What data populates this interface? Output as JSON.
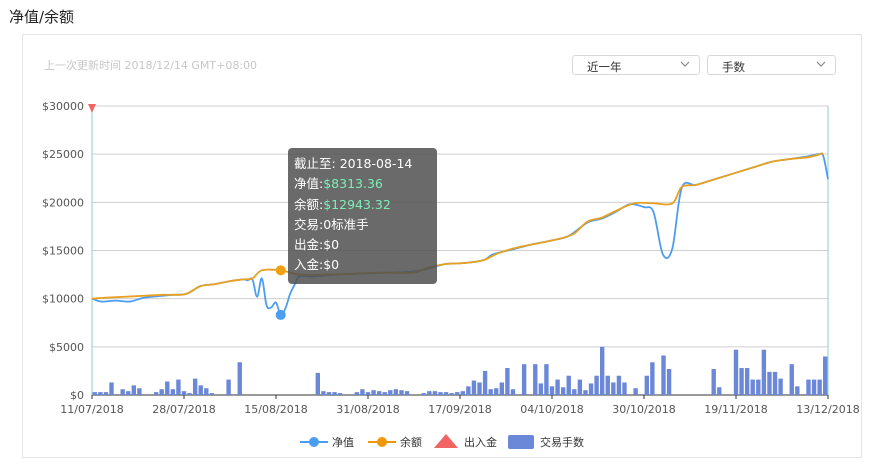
{
  "page": {
    "title": "净值/余额"
  },
  "header": {
    "updated": "上一次更新时间 2018/12/14 GMT+08:00",
    "range_select": "近一年",
    "unit_select": "手数"
  },
  "tooltip": {
    "date_label": "截止至:",
    "date_value": "2018-08-14",
    "equity_label": "净值:",
    "equity_value": "$8313.36",
    "balance_label": "余额:",
    "balance_value": "$12943.32",
    "trade_label": "交易:",
    "trade_value": "0标准手",
    "withdraw_label": "出金:",
    "withdraw_value": "$0",
    "deposit_label": "入金:",
    "deposit_value": "$0"
  },
  "legend": [
    {
      "label": "净值",
      "color": "#4a9df0",
      "icon": "line-circle-icon"
    },
    {
      "label": "余额",
      "color": "#f0960a",
      "icon": "line-circle-icon"
    },
    {
      "label": "出入金",
      "color": "#f06464",
      "icon": "triangle-icon"
    },
    {
      "label": "交易手数",
      "color": "#6b87d8",
      "icon": "bar-rect-icon"
    }
  ],
  "colors": {
    "equity": "#4a9df0",
    "balance": "#e8a020",
    "volume": "#6b87d8",
    "marker": "#f06464"
  },
  "chart_data": {
    "type": "line",
    "x_range": [
      "2018-07-11",
      "2018-12-14"
    ],
    "ylim": [
      0,
      30000
    ],
    "yticks": [
      "$0",
      "$5000",
      "$10000",
      "$15000",
      "$20000",
      "$25000",
      "$30000"
    ],
    "xticks": [
      "11/07/2018",
      "28/07/2018",
      "15/08/2018",
      "31/08/2018",
      "17/09/2018",
      "04/10/2018",
      "30/10/2018",
      "19/11/2018",
      "13/12/2018"
    ],
    "grid": true,
    "legend_position": "bottom",
    "series": [
      {
        "name": "净值",
        "points": [
          [
            "2018-07-11",
            10000
          ],
          [
            "2018-07-13",
            9700
          ],
          [
            "2018-07-16",
            9800
          ],
          [
            "2018-07-19",
            9700
          ],
          [
            "2018-07-22",
            10100
          ],
          [
            "2018-07-26",
            10300
          ],
          [
            "2018-07-28",
            10400
          ],
          [
            "2018-07-31",
            10500
          ],
          [
            "2018-08-03",
            11300
          ],
          [
            "2018-08-06",
            11500
          ],
          [
            "2018-08-09",
            11800
          ],
          [
            "2018-08-12",
            12000
          ],
          [
            "2018-08-13",
            11900
          ],
          [
            "2018-08-14",
            12000
          ],
          [
            "2018-08-15",
            10200
          ],
          [
            "2018-08-16",
            12100
          ],
          [
            "2018-08-17",
            9300
          ],
          [
            "2018-08-18",
            9100
          ],
          [
            "2018-08-19",
            9600
          ],
          [
            "2018-08-20",
            8313
          ],
          [
            "2018-08-21",
            9000
          ],
          [
            "2018-08-22",
            10500
          ],
          [
            "2018-08-23",
            11500
          ],
          [
            "2018-08-24",
            12300
          ],
          [
            "2018-08-27",
            12300
          ],
          [
            "2018-09-01",
            12500
          ],
          [
            "2018-09-06",
            12600
          ],
          [
            "2018-09-12",
            12700
          ],
          [
            "2018-09-17",
            12800
          ],
          [
            "2018-09-20",
            13100
          ],
          [
            "2018-09-24",
            13600
          ],
          [
            "2018-09-28",
            13700
          ],
          [
            "2018-10-02",
            14000
          ],
          [
            "2018-10-04",
            14600
          ],
          [
            "2018-10-08",
            15100
          ],
          [
            "2018-10-12",
            15600
          ],
          [
            "2018-10-16",
            16000
          ],
          [
            "2018-10-20",
            16500
          ],
          [
            "2018-10-24",
            17900
          ],
          [
            "2018-10-27",
            18300
          ],
          [
            "2018-10-30",
            19000
          ],
          [
            "2018-11-02",
            19800
          ],
          [
            "2018-11-05",
            19500
          ],
          [
            "2018-11-07",
            19000
          ],
          [
            "2018-11-09",
            14600
          ],
          [
            "2018-11-11",
            15200
          ],
          [
            "2018-11-13",
            21500
          ],
          [
            "2018-11-16",
            21800
          ],
          [
            "2018-11-20",
            22400
          ],
          [
            "2018-11-24",
            23000
          ],
          [
            "2018-11-28",
            23600
          ],
          [
            "2018-12-02",
            24200
          ],
          [
            "2018-12-06",
            24500
          ],
          [
            "2018-12-10",
            24800
          ],
          [
            "2018-12-12",
            25000
          ],
          [
            "2018-12-13",
            24800
          ],
          [
            "2018-12-14",
            22400
          ]
        ]
      },
      {
        "name": "余额",
        "points": [
          [
            "2018-07-11",
            10000
          ],
          [
            "2018-07-14",
            10100
          ],
          [
            "2018-07-18",
            10200
          ],
          [
            "2018-07-22",
            10300
          ],
          [
            "2018-07-26",
            10400
          ],
          [
            "2018-07-28",
            10400
          ],
          [
            "2018-07-31",
            10500
          ],
          [
            "2018-08-03",
            11300
          ],
          [
            "2018-08-06",
            11500
          ],
          [
            "2018-08-09",
            11800
          ],
          [
            "2018-08-12",
            12000
          ],
          [
            "2018-08-14",
            12100
          ],
          [
            "2018-08-16",
            12943
          ],
          [
            "2018-08-20",
            12943
          ],
          [
            "2018-08-24",
            12500
          ],
          [
            "2018-08-30",
            12500
          ],
          [
            "2018-09-05",
            12600
          ],
          [
            "2018-09-10",
            12700
          ],
          [
            "2018-09-17",
            12700
          ],
          [
            "2018-09-20",
            13200
          ],
          [
            "2018-09-24",
            13600
          ],
          [
            "2018-09-28",
            13700
          ],
          [
            "2018-10-02",
            14000
          ],
          [
            "2018-10-05",
            14700
          ],
          [
            "2018-10-09",
            15300
          ],
          [
            "2018-10-13",
            15700
          ],
          [
            "2018-10-17",
            16100
          ],
          [
            "2018-10-21",
            16700
          ],
          [
            "2018-10-24",
            18000
          ],
          [
            "2018-10-27",
            18400
          ],
          [
            "2018-10-30",
            19100
          ],
          [
            "2018-11-03",
            19900
          ],
          [
            "2018-11-07",
            19900
          ],
          [
            "2018-11-11",
            19900
          ],
          [
            "2018-11-13",
            21600
          ],
          [
            "2018-11-16",
            21800
          ],
          [
            "2018-11-20",
            22400
          ],
          [
            "2018-11-24",
            23000
          ],
          [
            "2018-11-28",
            23600
          ],
          [
            "2018-12-02",
            24200
          ],
          [
            "2018-12-06",
            24500
          ],
          [
            "2018-12-10",
            24700
          ],
          [
            "2018-12-13",
            25100
          ]
        ]
      },
      {
        "name": "交易手数",
        "type": "bar",
        "values": [
          0.3,
          0.3,
          0.3,
          1.3,
          0,
          0.6,
          0.4,
          1,
          0.7,
          0,
          0,
          0.3,
          0.6,
          1.4,
          0.6,
          1.6,
          0.4,
          0.2,
          1.7,
          1,
          0.7,
          0.2,
          0,
          0,
          1.6,
          0,
          3.4,
          0,
          0,
          0,
          0,
          0,
          0,
          0,
          0,
          0,
          0,
          0,
          0,
          0,
          2.3,
          0.4,
          0.3,
          0.3,
          0.2,
          0,
          0,
          0.3,
          0.6,
          0.3,
          0.5,
          0.4,
          0.3,
          0.5,
          0.6,
          0.5,
          0.4,
          0,
          0,
          0.2,
          0.4,
          0.4,
          0.3,
          0.3,
          0.2,
          0.3,
          0.4,
          0.9,
          1.5,
          1.3,
          2.5,
          0.6,
          0.7,
          1.3,
          2.8,
          0.6,
          0,
          3.2,
          0,
          3.2,
          1.2,
          3.2,
          0.9,
          1.6,
          0.8,
          2,
          0.6,
          1.6,
          0.5,
          1.2,
          2,
          5,
          2,
          1.3,
          2,
          1.3,
          0,
          0.7,
          0,
          2,
          3.4,
          0,
          4.1,
          2.7,
          0,
          0,
          0,
          0,
          0,
          0,
          0,
          2.7,
          0.8,
          0,
          0,
          4.7,
          2.8,
          2.8,
          1.6,
          1.6,
          4.7,
          2.4,
          2.4,
          1.7,
          0,
          3.2,
          0.9,
          0,
          1.6,
          1.6,
          1.6,
          4
        ]
      },
      {
        "name": "出入金",
        "type": "marker",
        "points": [
          [
            "2018-07-11",
            30000
          ]
        ]
      }
    ],
    "highlight": {
      "date": "2018-08-20",
      "equity": 8313.36,
      "balance": 12943.32
    }
  }
}
